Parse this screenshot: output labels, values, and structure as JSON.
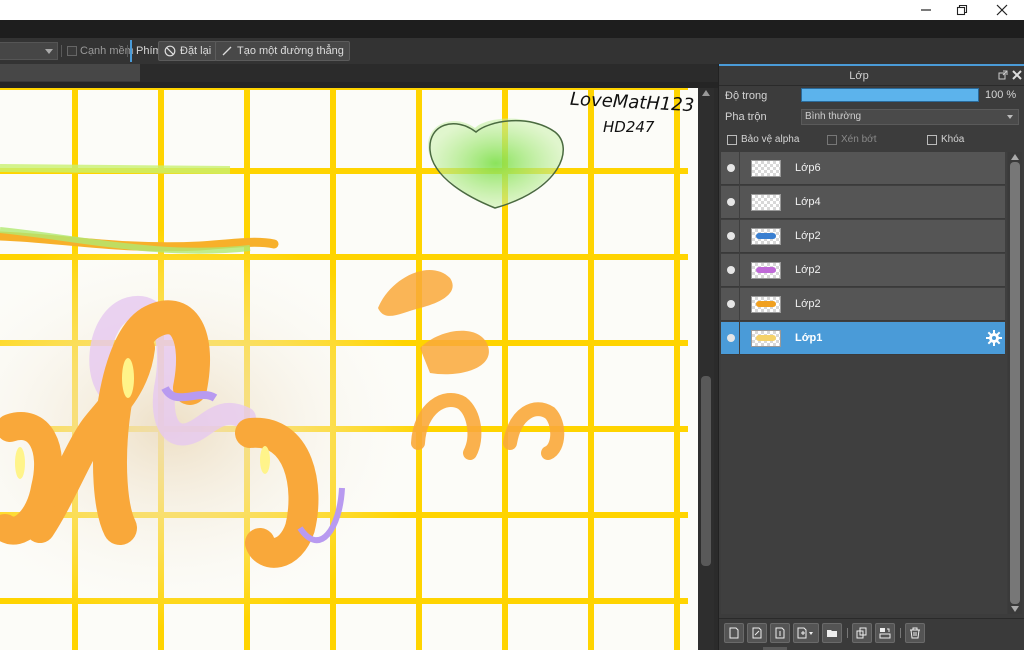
{
  "window": {
    "controls": {
      "minimize_icon": "minimize-icon",
      "restore_icon": "restore-icon",
      "close_icon": "close-icon"
    }
  },
  "toolbar": {
    "antialias_label": "Cạnh mềm",
    "antialias_checked": false,
    "shortcut_label": "Phím",
    "reset_label": "Đặt lại",
    "straight_line_label": "Tạo một đường thẳng"
  },
  "canvas": {
    "handwriting_line1": "LoveMatH123",
    "handwriting_line2": "HD247",
    "grid_color": "#ffd400"
  },
  "layer_panel": {
    "title": "Lớp",
    "opacity_label": "Độ trong",
    "opacity_value": "100 %",
    "opacity_fraction": 1.0,
    "blend_label": "Pha trộn",
    "blend_value": "Bình thường",
    "protect_alpha_label": "Bảo vệ alpha",
    "clipping_label": "Xén bớt",
    "lock_label": "Khóa",
    "accent_color": "#4a9bd8",
    "layers": [
      {
        "name": "Lớp6",
        "visible": true,
        "active": false,
        "thumb_mark": ""
      },
      {
        "name": "Lớp4",
        "visible": true,
        "active": false,
        "thumb_mark": ""
      },
      {
        "name": "Lớp2",
        "visible": true,
        "active": false,
        "thumb_mark": "#3a7fd0"
      },
      {
        "name": "Lớp2",
        "visible": true,
        "active": false,
        "thumb_mark": "#c06ad8"
      },
      {
        "name": "Lớp2",
        "visible": true,
        "active": false,
        "thumb_mark": "#f0a020"
      },
      {
        "name": "Lớp1",
        "visible": true,
        "active": true,
        "thumb_mark": "#f5d26a"
      }
    ],
    "footer_icons": [
      "new-raster-layer-icon",
      "new-vector-layer-icon",
      "new-halftone-layer-icon",
      "add-layer-menu-icon",
      "new-folder-icon",
      "duplicate-layer-icon",
      "merge-down-icon",
      "delete-layer-icon"
    ]
  }
}
